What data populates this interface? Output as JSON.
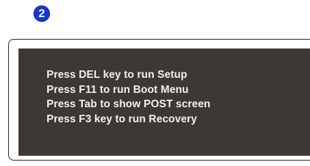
{
  "step": {
    "number": "2",
    "color": "#1537d6"
  },
  "post_screen": {
    "background_color": "#3d3834",
    "text_color": "#f2f2f2",
    "lines": [
      "Press DEL key to run Setup",
      "Press F11 to run Boot Menu",
      "Press Tab to show POST screen",
      "Press F3 key to run Recovery"
    ]
  }
}
